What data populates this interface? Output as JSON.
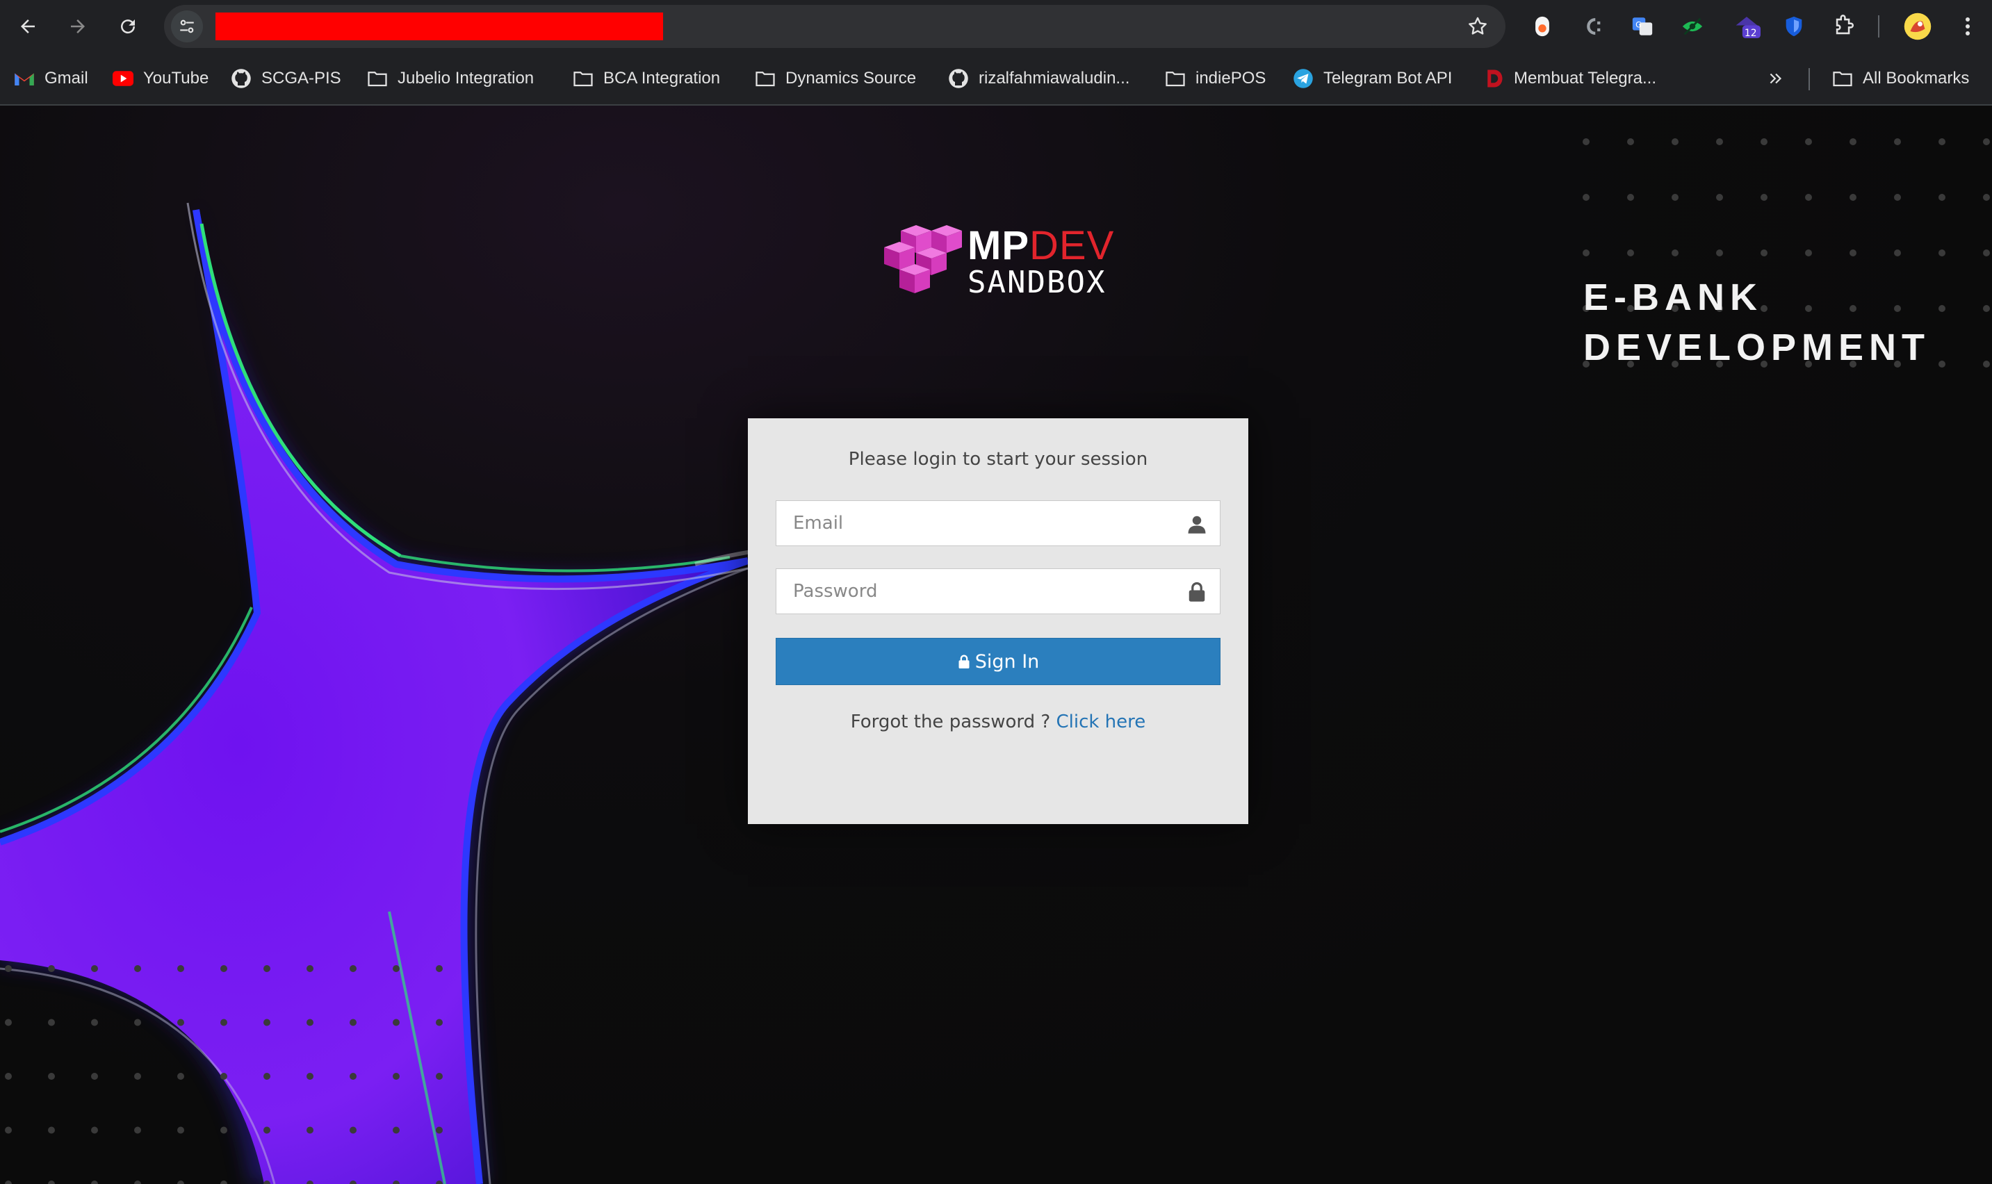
{
  "browser": {
    "bookmarks": [
      {
        "label": "Gmail",
        "icon": "gmail-icon"
      },
      {
        "label": "YouTube",
        "icon": "youtube-icon"
      },
      {
        "label": "SCGA-PIS",
        "icon": "github-icon"
      },
      {
        "label": "Jubelio Integration",
        "icon": "folder-icon"
      },
      {
        "label": "BCA Integration",
        "icon": "folder-icon"
      },
      {
        "label": "Dynamics Source",
        "icon": "folder-icon"
      },
      {
        "label": "rizalfahmiawaludin...",
        "icon": "github-icon"
      },
      {
        "label": "indiePOS",
        "icon": "folder-icon"
      },
      {
        "label": "Telegram Bot API",
        "icon": "telegram-icon"
      },
      {
        "label": "Membuat Telegra...",
        "icon": "dicoding-icon"
      }
    ],
    "all_bookmarks_label": "All Bookmarks",
    "extension_badge": "12"
  },
  "logo": {
    "part1": "MP",
    "part2": "DEV",
    "part3": "SANDBOX"
  },
  "brand": {
    "line1": "E-BANK",
    "line2": "DEVELOPMENT"
  },
  "login": {
    "message": "Please login to start your session",
    "email_placeholder": "Email",
    "password_placeholder": "Password",
    "signin_label": "Sign In",
    "forgot_text": "Forgot the password ?",
    "forgot_link": "Click here"
  },
  "colors": {
    "accent_button": "#2b7fbe",
    "link": "#2474b5",
    "logo_red": "#e2242c",
    "logo_pink": "#d63cbd",
    "star_purple": "#7a1cf0"
  }
}
